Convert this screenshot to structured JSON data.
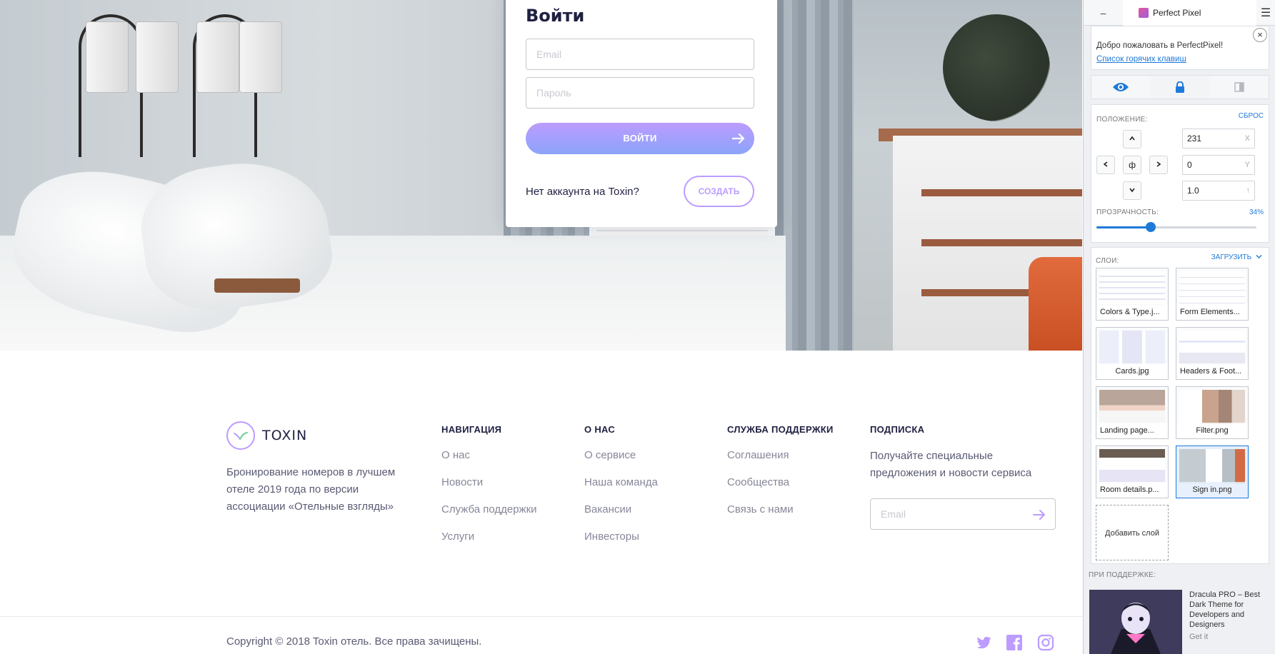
{
  "login": {
    "title": "Войти",
    "email_placeholder": "Email",
    "password_placeholder": "Пароль",
    "submit_label": "ВОЙТИ",
    "no_account_text": "Нет аккаунта на Toxin?",
    "create_label": "СОЗДАТЬ"
  },
  "footer": {
    "logo_text": "TOXIN",
    "about": "Бронирование номеров в лучшем отеле 2019 года по версии ассоциации «Отельные взгляды»",
    "columns": [
      {
        "title": "НАВИГАЦИЯ",
        "links": [
          "О нас",
          "Новости",
          "Служба поддержки",
          "Услуги"
        ]
      },
      {
        "title": "О НАС",
        "links": [
          "О сервисе",
          "Наша команда",
          "Вакансии",
          "Инвесторы"
        ]
      },
      {
        "title": "СЛУЖБА ПОДДЕРЖКИ",
        "links": [
          "Соглашения",
          "Сообщества",
          "Связь с нами"
        ]
      }
    ],
    "subscribe": {
      "title": "ПОДПИСКА",
      "text": "Получайте специальные предложения и новости сервиса",
      "email_placeholder": "Email"
    },
    "copyright": "Copyright © 2018 Toxin отель. Все права зачищены.",
    "social_icons": [
      "twitter-icon",
      "facebook-icon",
      "instagram-icon"
    ]
  },
  "perfect_pixel": {
    "minimize_label": "–",
    "title": "Perfect Pixel",
    "menu_icon": "☰",
    "welcome_text": "Добро пожаловать в PerfectPixel!",
    "hotkeys_link": "Список горячих клавиш",
    "close_label": "×",
    "position_label": "ПОЛОЖЕНИЕ:",
    "reset_label": "СБРОС",
    "center_label": "ф",
    "x_value": "231",
    "y_value": "0",
    "scale_value": "1.0",
    "x_axis": "X",
    "y_axis": "Y",
    "scale_axis": "↑",
    "opacity_label": "ПРОЗРАЧНОСТЬ:",
    "opacity_text": "34%",
    "opacity_value": 0.34,
    "layers_label": "СЛОИ:",
    "upload_label": "ЗАГРУЗИТЬ",
    "layers": [
      {
        "name": "Colors & Type.j..."
      },
      {
        "name": "Form Elements..."
      },
      {
        "name": "Cards.jpg"
      },
      {
        "name": "Headers & Foot..."
      },
      {
        "name": "Landing page..."
      },
      {
        "name": "Filter.png"
      },
      {
        "name": "Room details.p..."
      },
      {
        "name": "Sign in.png",
        "selected": true
      }
    ],
    "add_layer_label": "Добавить слой",
    "sponsor_label": "ПРИ ПОДДЕРЖКЕ:",
    "sponsor_text": "Dracula PRO – Best Dark Theme for Developers and Designers",
    "sponsor_link": "Get it",
    "accent": "#1e7ad9"
  },
  "colors": {
    "purple": "#bc9cff",
    "blue_gradient_end": "#8ba4f9",
    "dark": "#1f2041"
  }
}
